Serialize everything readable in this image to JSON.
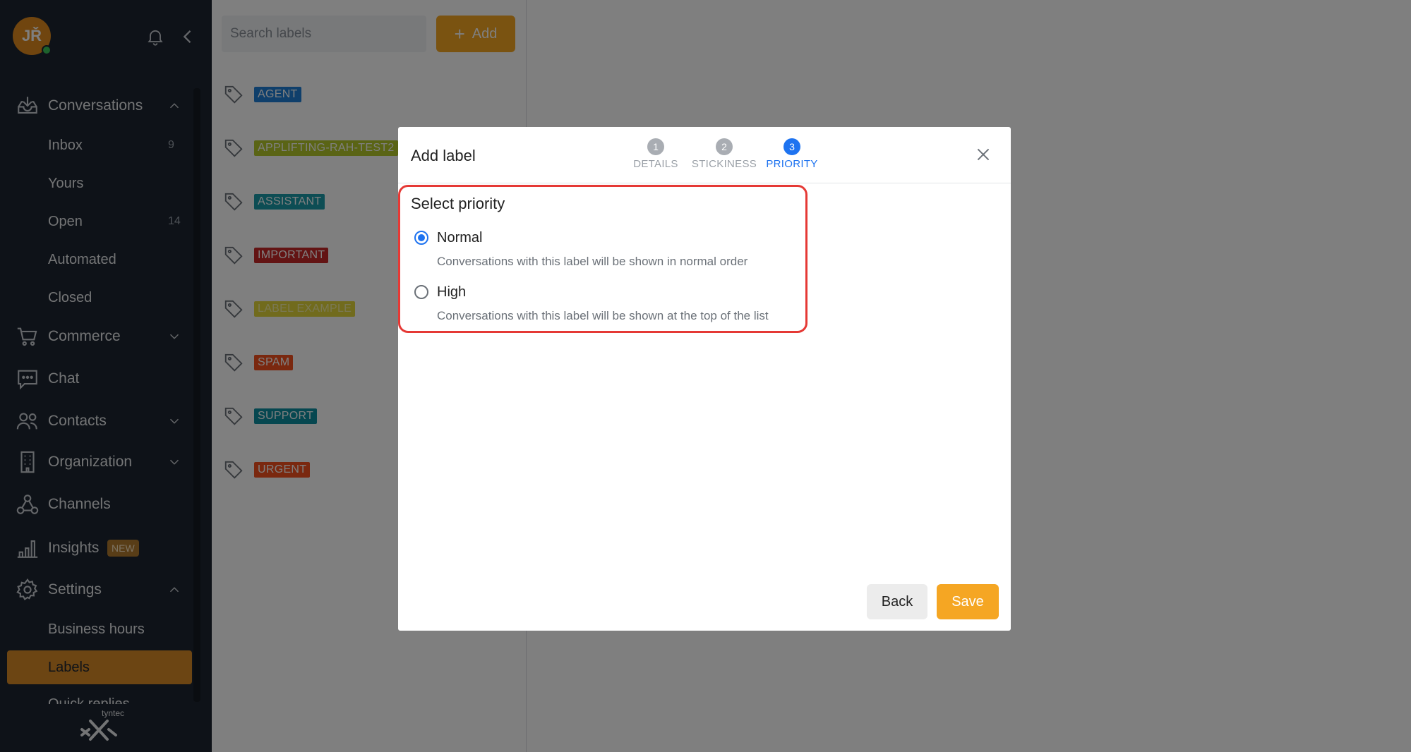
{
  "user": {
    "initials": "JŘ",
    "status_color": "#3ac45a"
  },
  "sidebar": {
    "conversations": {
      "label": "Conversations",
      "items": [
        {
          "label": "Inbox",
          "count": "9"
        },
        {
          "label": "Yours",
          "count": ""
        },
        {
          "label": "Open",
          "count": "14"
        },
        {
          "label": "Automated",
          "count": ""
        },
        {
          "label": "Closed",
          "count": ""
        }
      ]
    },
    "commerce": "Commerce",
    "chat": "Chat",
    "contacts": "Contacts",
    "organization": "Organization",
    "channels": "Channels",
    "insights": {
      "label": "Insights",
      "badge": "NEW"
    },
    "settings": {
      "label": "Settings",
      "items": [
        {
          "label": "Business hours"
        },
        {
          "label": "Labels"
        },
        {
          "label": "Quick replies"
        }
      ]
    },
    "brand": "tyntec"
  },
  "labels_panel": {
    "search_placeholder": "Search labels",
    "add_label": "Add",
    "labels": [
      {
        "name": "AGENT",
        "bg": "#1e7fd6",
        "fg": "#ffffff"
      },
      {
        "name": "APPLIFTING-RAH-TEST2",
        "bg": "#b5c92a",
        "fg": "#ffffff"
      },
      {
        "name": "ASSISTANT",
        "bg": "#1a9aa8",
        "fg": "#ffffff"
      },
      {
        "name": "IMPORTANT",
        "bg": "#c62828",
        "fg": "#ffffff"
      },
      {
        "name": "LABEL EXAMPLE",
        "bg": "#e2d63a",
        "fg": "#f5f0a8"
      },
      {
        "name": "SPAM",
        "bg": "#f4511e",
        "fg": "#ffffff"
      },
      {
        "name": "SUPPORT",
        "bg": "#0d8fa0",
        "fg": "#ffffff"
      },
      {
        "name": "URGENT",
        "bg": "#f4511e",
        "fg": "#ffffff"
      }
    ]
  },
  "modal": {
    "title": "Add label",
    "steps": [
      {
        "num": "1",
        "name": "DETAILS"
      },
      {
        "num": "2",
        "name": "STICKINESS"
      },
      {
        "num": "3",
        "name": "PRIORITY"
      }
    ],
    "section_title": "Select priority",
    "options": [
      {
        "label": "Normal",
        "desc": "Conversations with this label will be shown in normal order",
        "checked": true
      },
      {
        "label": "High",
        "desc": "Conversations with this label will be shown at the top of the list",
        "checked": false
      }
    ],
    "back_label": "Back",
    "save_label": "Save"
  },
  "colors": {
    "accent": "#f5a623",
    "sidebar_bg": "#1d2530",
    "step_active": "#1e73f0",
    "highlight": "#e53935"
  }
}
